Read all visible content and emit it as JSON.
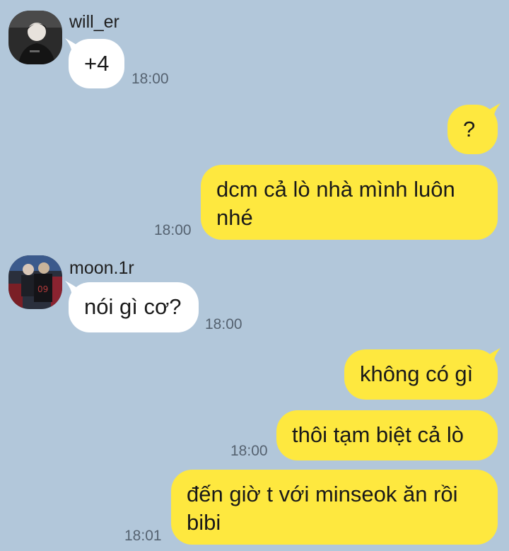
{
  "colors": {
    "background": "#b2c7da",
    "incoming_bubble": "#ffffff",
    "outgoing_bubble": "#fee83f",
    "timestamp": "#556270"
  },
  "messages": [
    {
      "direction": "incoming",
      "sender": "will_er",
      "avatar": "avatar-photo",
      "lines": [
        "+4"
      ],
      "time": "18:00"
    },
    {
      "direction": "outgoing",
      "lines": [
        "?"
      ],
      "time": ""
    },
    {
      "direction": "outgoing",
      "lines": [
        "dcm cả lò nhà mình luôn",
        "nhé"
      ],
      "time": "18:00"
    },
    {
      "direction": "incoming",
      "sender": "moon.1r",
      "avatar": "avatar-photo",
      "lines": [
        "nói gì cơ?"
      ],
      "time": "18:00"
    },
    {
      "direction": "outgoing",
      "lines": [
        "không có gì"
      ],
      "time": ""
    },
    {
      "direction": "outgoing",
      "lines": [
        "thôi tạm biệt cả lò"
      ],
      "time": "18:00"
    },
    {
      "direction": "outgoing",
      "lines": [
        "đến giờ t với minseok ăn rồi",
        "bibi"
      ],
      "time": "18:01"
    }
  ]
}
